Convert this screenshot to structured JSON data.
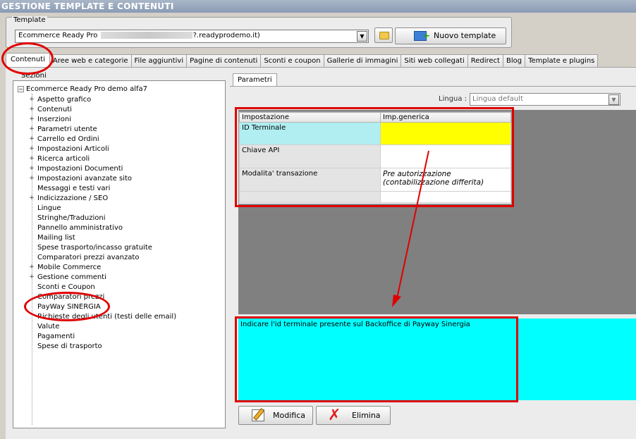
{
  "titlebar": {
    "title": "GESTIONE TEMPLATE E CONTENUTI"
  },
  "template": {
    "legend": "Template",
    "selected_prefix": "Ecommerce Ready Pro",
    "selected_suffix": "?.readyprodemo.it)",
    "new_button": "Nuovo template"
  },
  "tabs": [
    {
      "label": "Contenuti"
    },
    {
      "label": "Aree web e categorie"
    },
    {
      "label": "File aggiuntivi"
    },
    {
      "label": "Pagine di contenuti"
    },
    {
      "label": "Sconti e coupon"
    },
    {
      "label": "Gallerie di immagini"
    },
    {
      "label": "Siti web collegati"
    },
    {
      "label": "Redirect"
    },
    {
      "label": "Blog"
    },
    {
      "label": "Template e plugins"
    }
  ],
  "tree": {
    "label": "Sezioni",
    "root": "Ecommerce Ready Pro demo alfa7",
    "items": [
      {
        "label": "Aspetto grafico",
        "expand": "+"
      },
      {
        "label": "Contenuti",
        "expand": "+"
      },
      {
        "label": "Inserzioni",
        "expand": "+"
      },
      {
        "label": "Parametri utente",
        "expand": "+"
      },
      {
        "label": "Carrello ed Ordini",
        "expand": "+"
      },
      {
        "label": "Impostazioni Articoli",
        "expand": "+"
      },
      {
        "label": "Ricerca articoli",
        "expand": "+"
      },
      {
        "label": "Impostazioni Documenti",
        "expand": "+"
      },
      {
        "label": "Impostazioni avanzate sito",
        "expand": "+"
      },
      {
        "label": "Messaggi e testi vari",
        "expand": ""
      },
      {
        "label": "Indicizzazione / SEO",
        "expand": "+"
      },
      {
        "label": "Lingue",
        "expand": ""
      },
      {
        "label": "Stringhe/Traduzioni",
        "expand": ""
      },
      {
        "label": "Pannello amministrativo",
        "expand": ""
      },
      {
        "label": "Mailing list",
        "expand": ""
      },
      {
        "label": "Spese trasporto/incasso gratuite",
        "expand": ""
      },
      {
        "label": "Comparatori prezzi avanzato",
        "expand": ""
      },
      {
        "label": "Mobile Commerce",
        "expand": "+"
      },
      {
        "label": "Gestione commenti",
        "expand": "+"
      },
      {
        "label": "Sconti e Coupon",
        "expand": ""
      },
      {
        "label": "Comparatori prezzi",
        "expand": ""
      },
      {
        "label": "PayWay SINERGIA",
        "expand": ""
      },
      {
        "label": "Richieste degli utenti (testi delle email)",
        "expand": ""
      },
      {
        "label": "Valute",
        "expand": ""
      },
      {
        "label": "Pagamenti",
        "expand": ""
      },
      {
        "label": "Spese di trasporto",
        "expand": ""
      }
    ]
  },
  "params": {
    "tab": "Parametri",
    "lingua_label": "Lingua :",
    "lingua_value": "Lingua default",
    "columns": [
      "Impostazione",
      "Imp.generica"
    ],
    "rows": [
      {
        "key": "ID Terminale",
        "value": ""
      },
      {
        "key": "Chiave API",
        "value": ""
      },
      {
        "key": "Modalita' transazione",
        "value": "Pre autorizzazione (contabilizzazione differita)"
      },
      {
        "key": "",
        "value": ""
      }
    ],
    "description": "Indicare l'id terminale presente sul Backoffice di Payway Sinergia"
  },
  "actions": {
    "edit": "Modifica",
    "delete": "Elimina"
  },
  "colors": {
    "highlight_value": "#ffff00",
    "description_bg": "#00ffff",
    "annotation": "#e00000",
    "selected_key": "#b0eef2"
  }
}
